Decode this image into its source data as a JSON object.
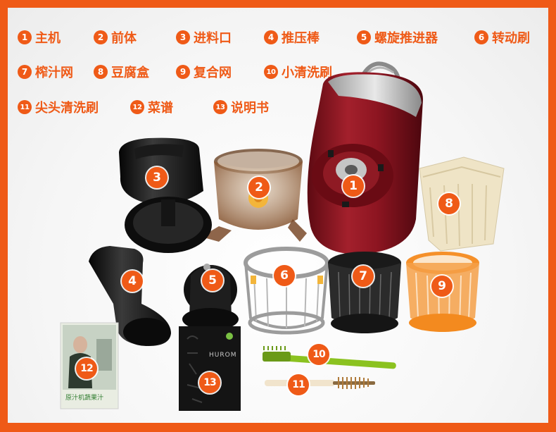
{
  "legend": [
    {
      "num": "1",
      "label": "主机"
    },
    {
      "num": "2",
      "label": "前体"
    },
    {
      "num": "3",
      "label": "进料口"
    },
    {
      "num": "4",
      "label": "推压棒"
    },
    {
      "num": "5",
      "label": "螺旋推进器"
    },
    {
      "num": "6",
      "label": "转动刷"
    },
    {
      "num": "7",
      "label": "榨汁网"
    },
    {
      "num": "8",
      "label": "豆腐盒"
    },
    {
      "num": "9",
      "label": "复合网"
    },
    {
      "num": "10",
      "label": "小清洗刷"
    },
    {
      "num": "11",
      "label": "尖头清洗刷"
    },
    {
      "num": "12",
      "label": "菜谱"
    },
    {
      "num": "13",
      "label": "说明书"
    }
  ],
  "part_markers": [
    "1",
    "2",
    "3",
    "4",
    "5",
    "6",
    "7",
    "8",
    "9",
    "10",
    "11",
    "12",
    "13"
  ],
  "booklet_brand": "HUROM",
  "recipe_cover_text": "原汁机蔬果汁",
  "colors": {
    "accent": "#ef5a17",
    "machine_red": "#8e1420",
    "silver": "#c9c9c9",
    "tofu_box": "#efe4c6",
    "orange_net": "#f5902a",
    "green_brush": "#8bc220"
  }
}
